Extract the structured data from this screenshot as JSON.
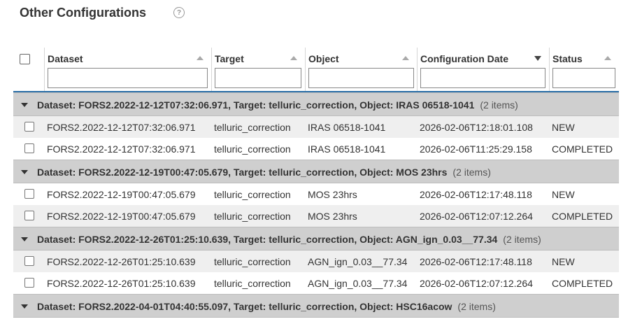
{
  "page": {
    "title": "Other Configurations",
    "help_icon": "question-circle-icon",
    "help_glyph": "?"
  },
  "columns": [
    {
      "label": "Dataset",
      "sort": "none"
    },
    {
      "label": "Target",
      "sort": "none"
    },
    {
      "label": "Object",
      "sort": "none"
    },
    {
      "label": "Configuration Date",
      "sort": "descending"
    },
    {
      "label": "Status",
      "sort": "none"
    }
  ],
  "filters": {
    "dataset": "",
    "target": "",
    "object": "",
    "configuration_date": "",
    "status": ""
  },
  "groups": [
    {
      "label": "Dataset: FORS2.2022-12-12T07:32:06.971, Target: telluric_correction, Object: IRAS 06518-1041",
      "count": "(2 items)",
      "rows": [
        {
          "dataset": "FORS2.2022-12-12T07:32:06.971",
          "target": "telluric_correction",
          "object": "IRAS 06518-1041",
          "date": "2026-02-06T12:18:01.108",
          "status": "NEW"
        },
        {
          "dataset": "FORS2.2022-12-12T07:32:06.971",
          "target": "telluric_correction",
          "object": "IRAS 06518-1041",
          "date": "2026-02-06T11:25:29.158",
          "status": "COMPLETED"
        }
      ]
    },
    {
      "label": "Dataset: FORS2.2022-12-19T00:47:05.679, Target: telluric_correction, Object: MOS 23hrs",
      "count": "(2 items)",
      "rows": [
        {
          "dataset": "FORS2.2022-12-19T00:47:05.679",
          "target": "telluric_correction",
          "object": "MOS 23hrs",
          "date": "2026-02-06T12:17:48.118",
          "status": "NEW"
        },
        {
          "dataset": "FORS2.2022-12-19T00:47:05.679",
          "target": "telluric_correction",
          "object": "MOS 23hrs",
          "date": "2026-02-06T12:07:12.264",
          "status": "COMPLETED"
        }
      ]
    },
    {
      "label": "Dataset: FORS2.2022-12-26T01:25:10.639, Target: telluric_correction, Object: AGN_ign_0.03__77.34",
      "count": "(2 items)",
      "rows": [
        {
          "dataset": "FORS2.2022-12-26T01:25:10.639",
          "target": "telluric_correction",
          "object": "AGN_ign_0.03__77.34",
          "date": "2026-02-06T12:17:48.118",
          "status": "NEW"
        },
        {
          "dataset": "FORS2.2022-12-26T01:25:10.639",
          "target": "telluric_correction",
          "object": "AGN_ign_0.03__77.34",
          "date": "2026-02-06T12:07:12.264",
          "status": "COMPLETED"
        }
      ]
    },
    {
      "label": "Dataset: FORS2.2022-04-01T04:40:55.097, Target: telluric_correction, Object: HSC16acow",
      "count": "(2 items)",
      "rows": []
    }
  ],
  "colors": {
    "accent": "#2a6ea6",
    "group_bg": "#cfcfcf",
    "alt_row_bg": "#efefef"
  }
}
